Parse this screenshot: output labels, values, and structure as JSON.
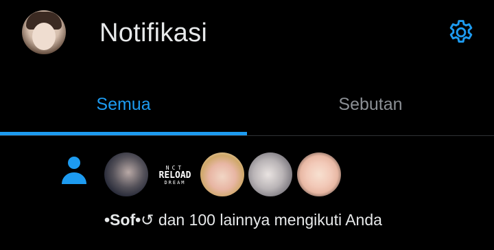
{
  "header": {
    "title": "Notifikasi",
    "avatar_icon": "user-avatar",
    "settings_icon": "gear-icon"
  },
  "tabs": [
    {
      "label": "Semua",
      "active": true
    },
    {
      "label": "Sebutan",
      "active": false
    }
  ],
  "notification": {
    "type_icon": "person-icon",
    "avatars": [
      "follower-avatar-1",
      "nct-reload-dream-avatar",
      "follower-avatar-3",
      "follower-avatar-4",
      "follower-avatar-5"
    ],
    "nct_logo": {
      "line1": "NCT",
      "line2": "RELOAD",
      "line3": "DREAM"
    },
    "name": "•Sof•",
    "name_symbol": "↺",
    "message": " dan 100 lainnya mengikuti Anda"
  },
  "colors": {
    "accent": "#1d9bf0",
    "background": "#000000",
    "text": "#e7e9ea",
    "muted": "#8b8f94"
  }
}
